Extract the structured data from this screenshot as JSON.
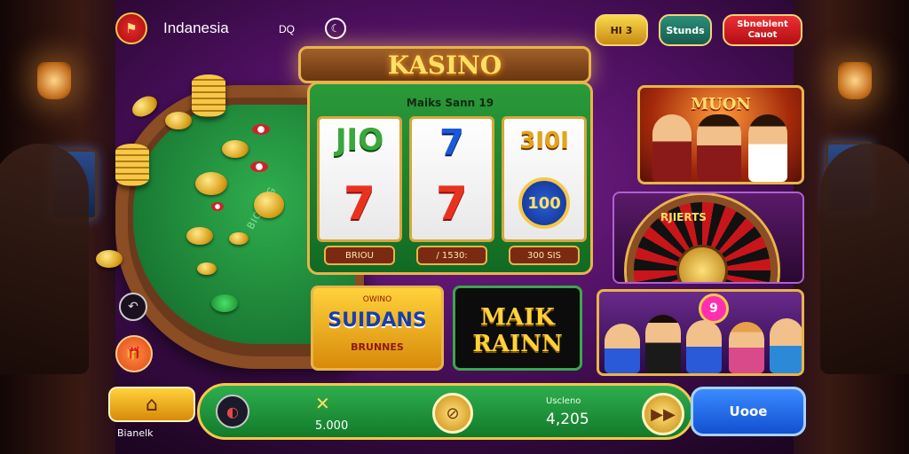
{
  "topbar": {
    "brand": "Indanesia",
    "lang": "DQ",
    "coins_label": "HI 3",
    "signin_label": "Stunds",
    "deposit_label": "Sbneblent Cauot"
  },
  "table": {
    "felt_text": "BIOIENG"
  },
  "slot": {
    "title": "KASINO",
    "subtitle": "Maiks Sann 19",
    "reels": [
      {
        "top": "JIO",
        "bottom": "7",
        "label": "BRIOU"
      },
      {
        "top": "7",
        "bottom": "7",
        "label": "/ 1530:"
      },
      {
        "top": "3I0I",
        "bottom": "100",
        "label": "300 SIS"
      }
    ]
  },
  "banners": {
    "suldans_top": "OWINO",
    "suldans_title": "SUIDANS",
    "suldans_sub": "BRUNNES",
    "maik_line1": "MAIK",
    "maik_line2": "RAINN",
    "moon_title": "MUON",
    "roulette_text": "RJIERTS",
    "crowd_badge": "9"
  },
  "bottombar": {
    "home_label": "Bianelk",
    "value1": "5.000",
    "label2": "Uscleno",
    "value2": "4,205",
    "play_label": "Uooe"
  },
  "colors": {
    "background": "#4a0f5c",
    "felt": "#1a7a33",
    "gold": "#e8b44a",
    "play_blue": "#1250d0",
    "deposit_red": "#ee2f34"
  },
  "icons": [
    "flag-icon",
    "moon-icon",
    "coin-icon",
    "home-icon",
    "back-icon",
    "gift-icon",
    "tools-icon",
    "arrow-icon"
  ]
}
